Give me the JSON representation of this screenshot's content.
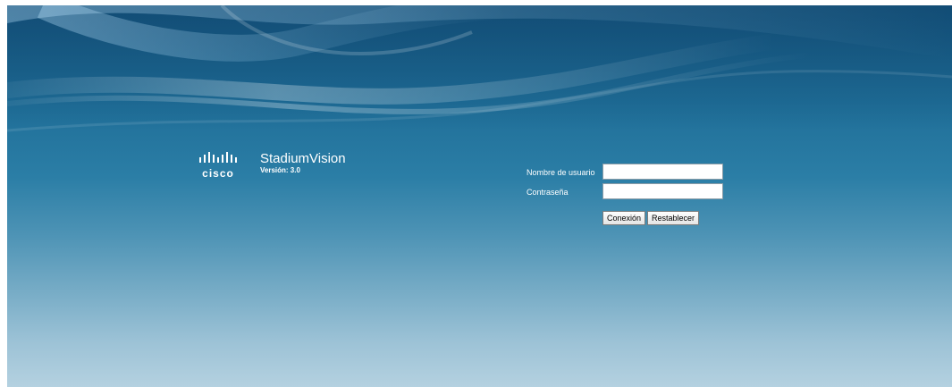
{
  "brand": {
    "logo_text": "cisco",
    "product": "StadiumVision",
    "version": "Versión: 3.0"
  },
  "login": {
    "username_label": "Nombre de usuario",
    "username_value": "",
    "password_label": "Contraseña",
    "password_value": "",
    "submit_label": "Conexión",
    "reset_label": "Restablecer"
  },
  "colors": {
    "background_top": "#1a5f8a",
    "background_bottom": "#b4d1e0",
    "text": "#ffffff"
  }
}
